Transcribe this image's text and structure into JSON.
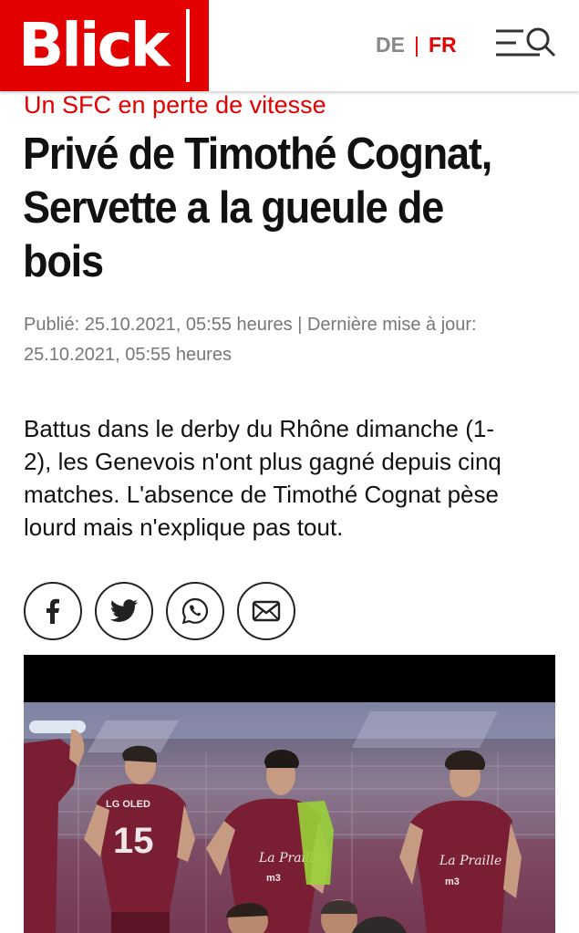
{
  "header": {
    "logo_text": "Blick",
    "lang": {
      "de": "DE",
      "separator": "|",
      "fr": "FR",
      "active": "FR"
    },
    "menu_icon": "menu-search-icon"
  },
  "article": {
    "kicker": "Un SFC en perte de vitesse",
    "headline_lines": [
      "Privé de Timothé Cognat,",
      "Servette a la gueule de",
      "bois"
    ],
    "meta_lines": [
      "Publié: 25.10.2021, 05:55 heures | Dernière mise à jour:",
      "25.10.2021, 05:55 heures"
    ],
    "lead_lines": [
      "Battus dans le derby du Rhône dimanche (1-",
      "2), les Genevois n'ont plus gagné depuis cinq",
      "matches. L'absence de Timothé Cognat pèse",
      "lourd mais n'explique pas tout."
    ]
  },
  "share": [
    "facebook-icon",
    "twitter-icon",
    "whatsapp-icon",
    "email-icon"
  ],
  "photo": {
    "jersey_number": "15",
    "sponsor_1": "LG OLED",
    "sponsor_2": "La Praille",
    "sponsor_3": "m3",
    "colors": {
      "brand_red": "#e20000",
      "jersey": "#7a1f33"
    }
  }
}
